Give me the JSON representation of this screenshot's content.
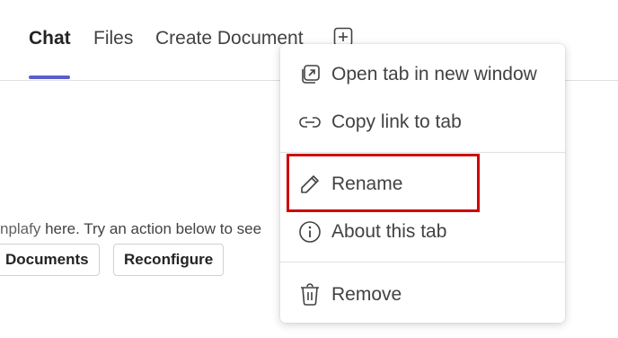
{
  "tabs": {
    "left_fragment": "",
    "items": [
      {
        "label": "Chat",
        "active": true
      },
      {
        "label": "Files",
        "active": false
      },
      {
        "label": "Create Document",
        "active": false
      }
    ],
    "add_icon": "plus-square-icon"
  },
  "content": {
    "text_prefix": "nplafy",
    "text_rest": " here. Try an action below to see",
    "buttons": [
      "Documents",
      "Reconfigure"
    ]
  },
  "context_menu": {
    "items": [
      {
        "label": "Open tab in new window",
        "icon": "open-new-window-icon"
      },
      {
        "label": "Copy link to tab",
        "icon": "link-icon"
      },
      {
        "label": "Rename",
        "icon": "pencil-icon"
      },
      {
        "label": "About this tab",
        "icon": "info-icon"
      },
      {
        "label": "Remove",
        "icon": "trash-icon"
      }
    ]
  },
  "colors": {
    "accent": "#5b5fc7",
    "highlight": "#d00000"
  }
}
